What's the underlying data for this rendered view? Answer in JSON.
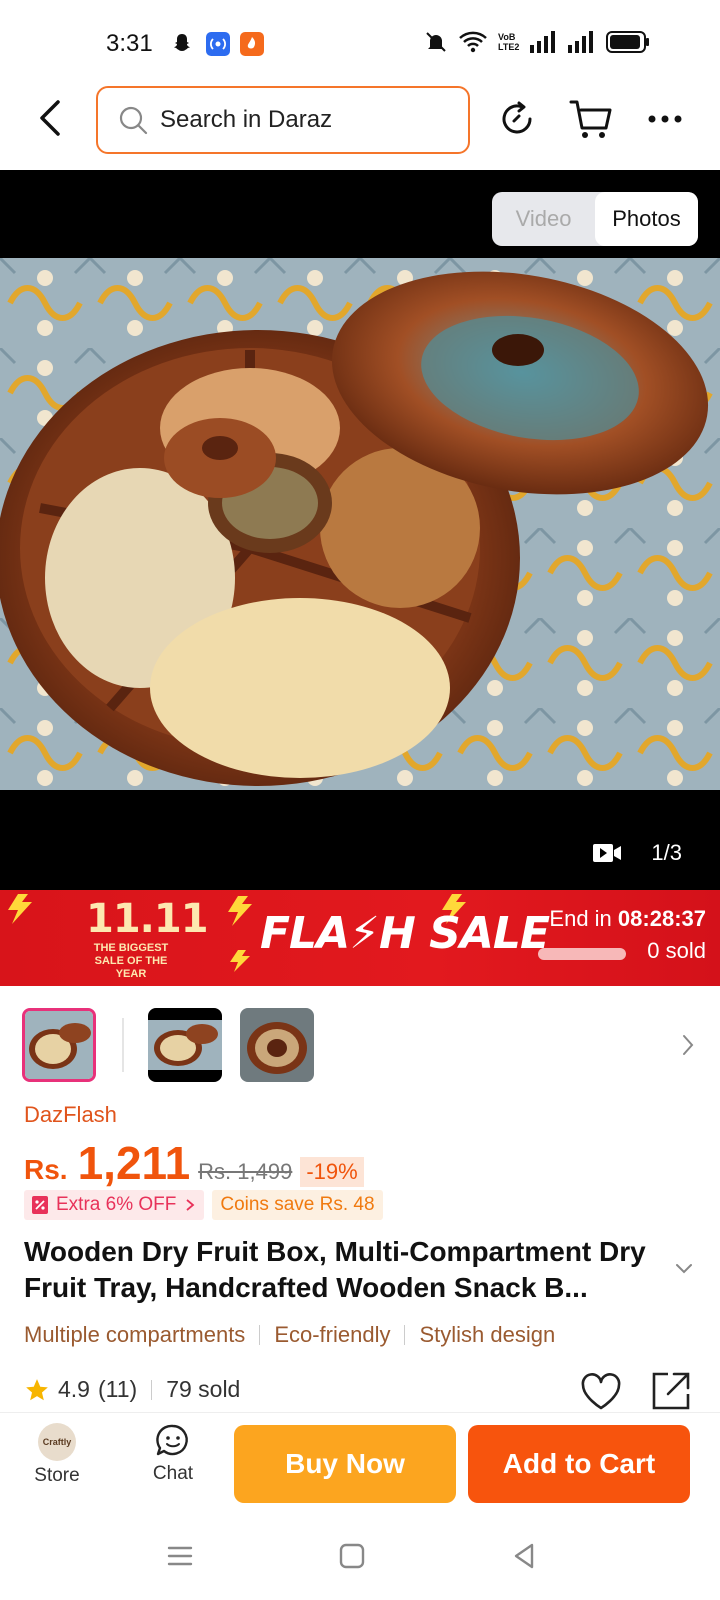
{
  "status_bar": {
    "time": "3:31",
    "icons": [
      "snapchat-icon",
      "hotspot-icon",
      "app-icon",
      "mute-icon",
      "wifi-icon",
      "volte-icon",
      "signal-icon",
      "signal-icon",
      "battery-icon"
    ],
    "volte_text": "VoB LTE2"
  },
  "nav": {
    "search_placeholder": "Search in Daraz",
    "icons": [
      "back-icon",
      "search-icon",
      "history-icon",
      "cart-icon",
      "more-icon"
    ]
  },
  "gallery": {
    "toggle": {
      "video": "Video",
      "photos": "Photos",
      "active": "photos"
    },
    "counter": "1/3"
  },
  "flash_sale": {
    "event": "11.11",
    "event_sub": "THE BIGGEST SALE OF THE YEAR",
    "title": "FLA⚡H SALE",
    "end_label": "End in",
    "end_time": "08:28:37",
    "sold": "0 sold",
    "progress": 0
  },
  "product": {
    "campaign": "DazFlash",
    "currency": "Rs.",
    "price": "1,211",
    "old_price": "Rs. 1,499",
    "discount": "-19%",
    "promo_extra": "Extra 6% OFF",
    "promo_coins": "Coins save Rs. 48",
    "title": "Wooden Dry Fruit Box, Multi-Compartment Dry Fruit Tray, Handcrafted Wooden Snack B...",
    "tags": [
      "Multiple compartments",
      "Eco-friendly",
      "Stylish design"
    ],
    "rating": "4.9",
    "reviews": "(11)",
    "sold": "79 sold"
  },
  "actions": {
    "store_label": "Store",
    "store_logo": "Craftly",
    "chat_label": "Chat",
    "buy_now": "Buy Now",
    "add_to_cart": "Add to Cart"
  },
  "colors": {
    "accent": "#f7540d",
    "buy": "#fca51f",
    "flash": "#e2191e",
    "price": "#f0540c"
  }
}
